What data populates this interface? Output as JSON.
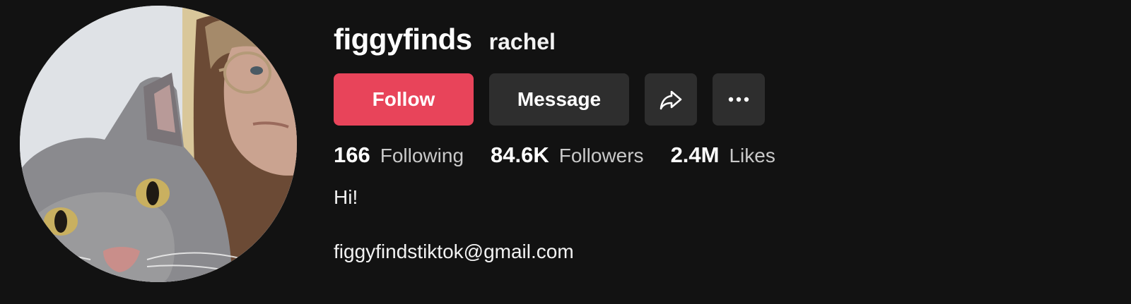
{
  "profile": {
    "username": "figgyfinds",
    "display_name": "rachel",
    "avatar_icon": "profile-photo",
    "bio": "Hi!",
    "email": "figgyfindstiktok@gmail.com"
  },
  "actions": {
    "follow_label": "Follow",
    "message_label": "Message",
    "share_icon": "share-icon",
    "more_icon": "more-icon"
  },
  "stats": {
    "following_count": "166",
    "following_label": "Following",
    "followers_count": "84.6K",
    "followers_label": "Followers",
    "likes_count": "2.4M",
    "likes_label": "Likes"
  },
  "colors": {
    "background": "#121212",
    "follow_button": "#e8445a",
    "secondary_button": "#2e2e2e"
  }
}
